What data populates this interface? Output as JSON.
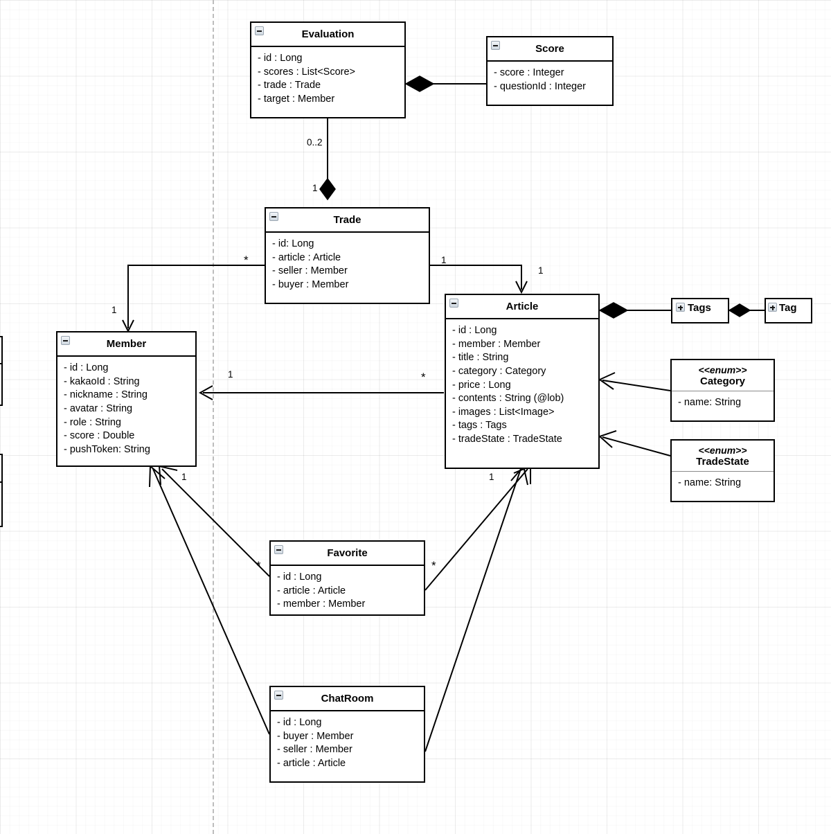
{
  "diagram": {
    "title": "UML Class Diagram",
    "background": "#ffffff",
    "grid_color": "#e8e8e8",
    "guide_line_color": "#bdbdbd",
    "line_color": "#000000"
  },
  "classes": {
    "evaluation": {
      "name": "Evaluation",
      "toggle": "collapse-minus",
      "attributes": [
        "- id : Long",
        "- scores : List<Score>",
        "- trade : Trade",
        "- target : Member"
      ]
    },
    "score": {
      "name": "Score",
      "toggle": "collapse-minus",
      "attributes": [
        "- score : Integer",
        "- questionId :  Integer"
      ]
    },
    "trade": {
      "name": "Trade",
      "toggle": "collapse-minus",
      "attributes": [
        "- id: Long",
        "- article : Article",
        "- seller : Member",
        "- buyer : Member"
      ]
    },
    "member": {
      "name": "Member",
      "toggle": "collapse-minus",
      "attributes": [
        "- id : Long",
        "- kakaoId : String",
        "- nickname : String",
        "- avatar : String",
        "- role : String",
        "- score : Double",
        "- pushToken: String"
      ]
    },
    "article": {
      "name": "Article",
      "toggle": "collapse-minus",
      "attributes": [
        "- id : Long",
        "- member : Member",
        "- title : String",
        "- category : Category",
        "- price : Long",
        "- contents : String (@lob)",
        "- images : List<Image>",
        "- tags : Tags",
        "- tradeState : TradeState"
      ]
    },
    "tags": {
      "name": "Tags",
      "toggle": "expand-plus",
      "attributes": []
    },
    "tag": {
      "name": "Tag",
      "toggle": "expand-plus",
      "attributes": []
    },
    "category": {
      "stereotype": "<<enum>>",
      "name": "Category",
      "toggle": "none",
      "attributes": [
        "- name: String"
      ]
    },
    "tradestate": {
      "stereotype": "<<enum>>",
      "name": "TradeState",
      "toggle": "none",
      "attributes": [
        "- name: String"
      ]
    },
    "favorite": {
      "name": "Favorite",
      "toggle": "collapse-minus",
      "attributes": [
        "- id : Long",
        "- article : Article",
        "- member : Member"
      ]
    },
    "chatroom": {
      "name": "ChatRoom",
      "toggle": "collapse-minus",
      "attributes": [
        "- id : Long",
        "- buyer : Member",
        "- seller : Member",
        "- article : Article"
      ]
    }
  },
  "multiplicities": {
    "evaluation_trade_source": "0..2",
    "trade_evaluation_target": "1",
    "trade_member_source": "*",
    "member_from_trade": "1",
    "trade_article_source": "1",
    "article_from_trade": "1",
    "member_from_article": "1",
    "article_to_member": "*",
    "member_from_favorite": "1",
    "favorite_to_member": "*",
    "favorite_to_article": "*",
    "article_from_favorite": "1"
  }
}
